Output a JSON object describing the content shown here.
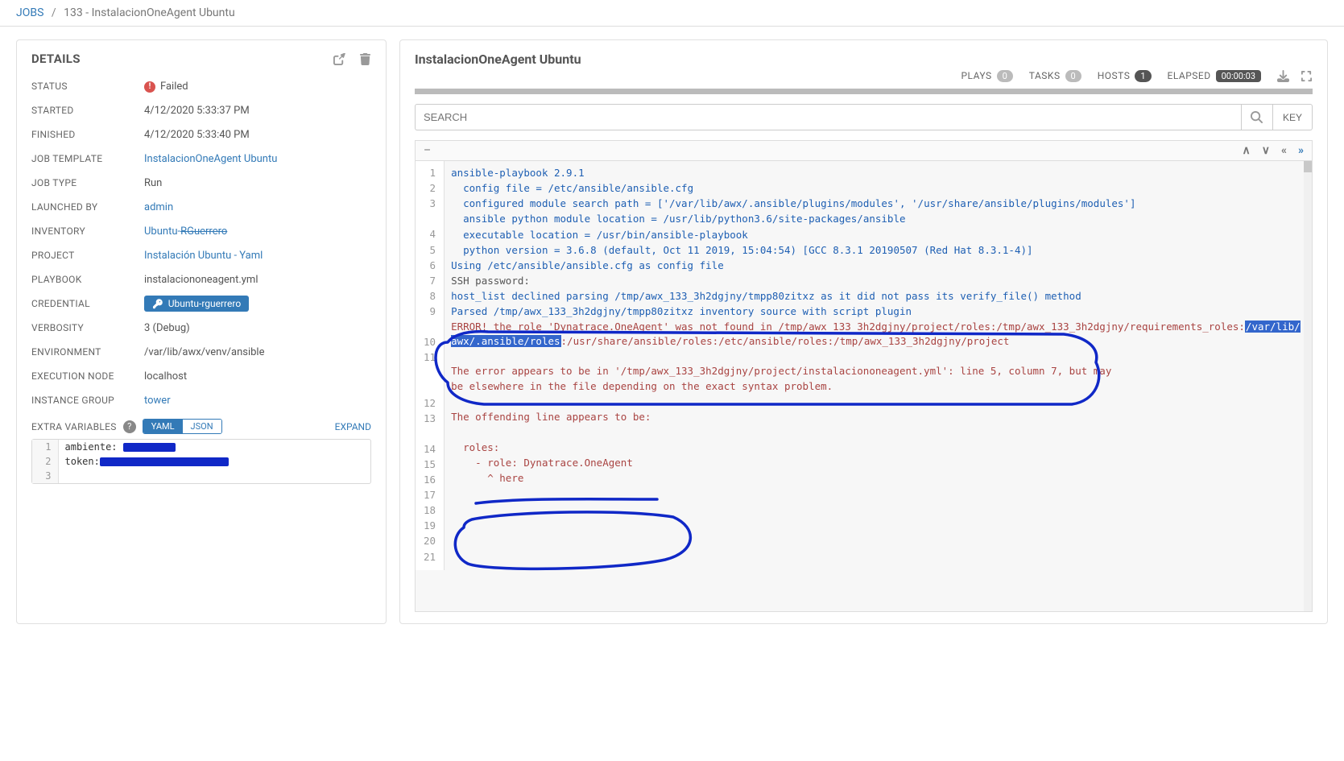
{
  "breadcrumb": {
    "root": "JOBS",
    "current": "133 - InstalacionOneAgent Ubuntu"
  },
  "leftPanel": {
    "title": "DETAILS",
    "rows": {
      "status_lbl": "STATUS",
      "status_val": "Failed",
      "started_lbl": "STARTED",
      "started_val": "4/12/2020 5:33:37 PM",
      "finished_lbl": "FINISHED",
      "finished_val": "4/12/2020 5:33:40 PM",
      "template_lbl": "JOB TEMPLATE",
      "template_val": "InstalacionOneAgent Ubuntu",
      "type_lbl": "JOB TYPE",
      "type_val": "Run",
      "launched_lbl": "LAUNCHED BY",
      "launched_val": "admin",
      "inventory_lbl": "INVENTORY",
      "inventory_pre": "Ubuntu-",
      "inventory_strike": "RGuerrero",
      "project_lbl": "PROJECT",
      "project_val": "Instalación Ubuntu - Yaml",
      "playbook_lbl": "PLAYBOOK",
      "playbook_val": "instalaciononeagent.yml",
      "credential_lbl": "CREDENTIAL",
      "credential_val": "Ubuntu-rguerrero",
      "verbosity_lbl": "VERBOSITY",
      "verbosity_val": "3 (Debug)",
      "env_lbl": "ENVIRONMENT",
      "env_val": "/var/lib/awx/venv/ansible",
      "exec_lbl": "EXECUTION NODE",
      "exec_val": "localhost",
      "group_lbl": "INSTANCE GROUP",
      "group_val": "tower"
    },
    "extra": {
      "label": "EXTRA VARIABLES",
      "yaml": "YAML",
      "json": "JSON",
      "expand": "EXPAND",
      "lines": {
        "l1": "ambiente: ",
        "l2": "token:",
        "l3": ""
      }
    }
  },
  "rightPanel": {
    "title": "InstalacionOneAgent Ubuntu",
    "stats": {
      "plays_lbl": "PLAYS",
      "plays_val": "0",
      "tasks_lbl": "TASKS",
      "tasks_val": "0",
      "hosts_lbl": "HOSTS",
      "hosts_val": "1",
      "elapsed_lbl": "ELAPSED",
      "elapsed_val": "00:00:03"
    },
    "search_placeholder": "SEARCH",
    "key_btn": "KEY",
    "collapse": "–",
    "output": {
      "l1": "ansible-playbook 2.9.1",
      "l2": "  config file = /etc/ansible/ansible.cfg",
      "l3": "  configured module search path = ['/var/lib/awx/.ansible/plugins/modules', '/usr/share/ansible/plugins/modules']",
      "l4": "  ansible python module location = /usr/lib/python3.6/site-packages/ansible",
      "l5": "  executable location = /usr/bin/ansible-playbook",
      "l6": "  python version = 3.6.8 (default, Oct 11 2019, 15:04:54) [GCC 8.3.1 20190507 (Red Hat 8.3.1-4)]",
      "l7": "Using /etc/ansible/ansible.cfg as config file",
      "l8": "SSH password:",
      "l9": "host_list declined parsing /tmp/awx_133_3h2dgjny/tmpp80zitxz as it did not pass its verify_file() method",
      "l10": "Parsed /tmp/awx_133_3h2dgjny/tmpp80zitxz inventory source with script plugin",
      "l11_a": "ERROR! the role 'Dynatrace.OneAgent' was not found in /tmp/awx_133_3h2dgjny/project/roles:/tmp/awx_133_3h2dgjny/requirements_roles:",
      "l11_hl": "/var/lib/awx/.ansible/roles",
      "l11_b": ":/usr/share/ansible/roles:/etc/ansible/roles:/tmp/awx_133_3h2dgjny/project",
      "l12": "",
      "l13": "The error appears to be in '/tmp/awx_133_3h2dgjny/project/instalaciononeagent.yml': line 5, column 7, but may",
      "l14": "be elsewhere in the file depending on the exact syntax problem.",
      "l15": "",
      "l16": "The offending line appears to be:",
      "l17": "",
      "l18": "  roles:",
      "l19": "    - role: Dynatrace.OneAgent",
      "l20": "      ^ here",
      "l21": ""
    }
  }
}
